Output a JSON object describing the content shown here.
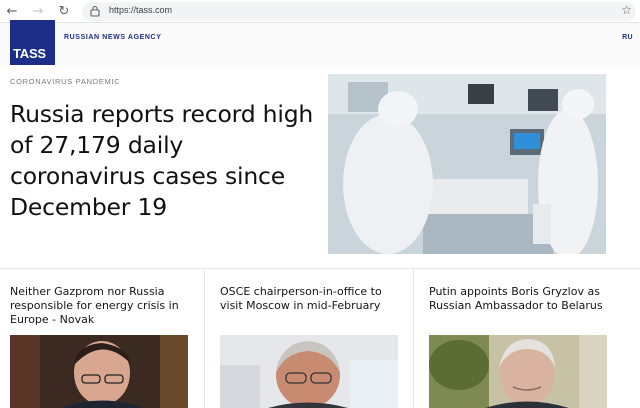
{
  "browser": {
    "url": "https://tass.com"
  },
  "site": {
    "logo_text": "TASS",
    "tagline": "RUSSIAN NEWS AGENCY",
    "language": "RU",
    "brand_color": "#1d2e89"
  },
  "hero": {
    "category": "CORONAVIRUS PANDEMIC",
    "headline": "Russia reports record high of 27,179 daily coronavirus cases since December 19",
    "image": "medical-staff-in-protective-suits-photo"
  },
  "cards": [
    {
      "title": "Neither Gazprom nor Russia responsible for energy crisis in Europe - Novak",
      "image": "man-in-glasses-portrait"
    },
    {
      "title": "OSCE chairperson-in-office to visit Moscow in mid-February",
      "image": "man-at-press-conference-portrait"
    },
    {
      "title": "Putin appoints Boris Gryzlov as Russian Ambassador to Belarus",
      "image": "gray-haired-man-portrait"
    }
  ]
}
